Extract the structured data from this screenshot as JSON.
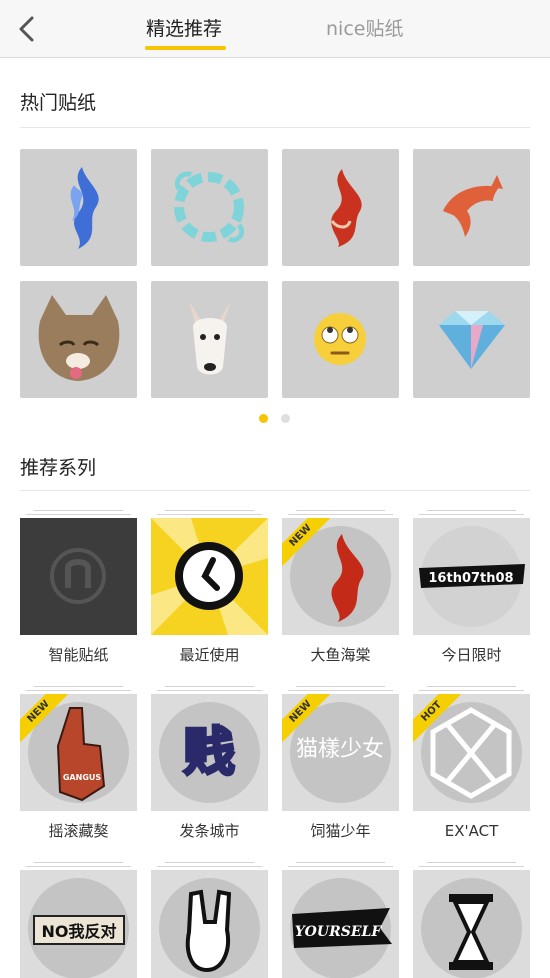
{
  "nav": {
    "tabs": [
      {
        "label": "精选推荐",
        "active": true
      },
      {
        "label": "nice贴纸",
        "active": false
      }
    ],
    "accent": "#f6c400"
  },
  "hot": {
    "title": "热门贴纸",
    "stickers": [
      {
        "icon": "blue-flame-sticker-icon"
      },
      {
        "icon": "water-ring-sticker-icon"
      },
      {
        "icon": "red-flame-sticker-icon"
      },
      {
        "icon": "dolphin-sticker-icon"
      },
      {
        "icon": "cat-face-sticker-icon"
      },
      {
        "icon": "bull-terrier-sticker-icon"
      },
      {
        "icon": "eye-roll-emoji-sticker-icon"
      },
      {
        "icon": "diamond-sticker-icon"
      }
    ],
    "pager": {
      "current": 1,
      "total": 2
    }
  },
  "series": {
    "title": "推荐系列",
    "items": [
      {
        "label": "智能贴纸",
        "badge": "",
        "icon": "n-logo-icon"
      },
      {
        "label": "最近使用",
        "badge": "",
        "icon": "clock-icon"
      },
      {
        "label": "大鱼海棠",
        "badge": "NEW",
        "icon": "red-flame-icon"
      },
      {
        "label": "今日限时",
        "badge": "",
        "icon": "date-banner-icon",
        "cover_text": "16th07th08"
      },
      {
        "label": "摇滚藏獒",
        "badge": "NEW",
        "icon": "foam-finger-icon",
        "cover_text": "GANGUS"
      },
      {
        "label": "发条城市",
        "badge": "",
        "icon": "graffiti-icon",
        "cover_text": "贱"
      },
      {
        "label": "饲猫少年",
        "badge": "NEW",
        "icon": "calligraphy-icon",
        "cover_text": "猫樣少女"
      },
      {
        "label": "EX'ACT",
        "badge": "HOT",
        "icon": "exo-hexagon-icon"
      },
      {
        "label": "",
        "badge": "",
        "icon": "no-sign-icon",
        "cover_text": "NO我反对"
      },
      {
        "label": "",
        "badge": "",
        "icon": "rock-hand-icon"
      },
      {
        "label": "",
        "badge": "",
        "icon": "pennant-icon",
        "cover_text": "YOURSELF"
      },
      {
        "label": "",
        "badge": "",
        "icon": "hourglass-icon"
      }
    ]
  }
}
